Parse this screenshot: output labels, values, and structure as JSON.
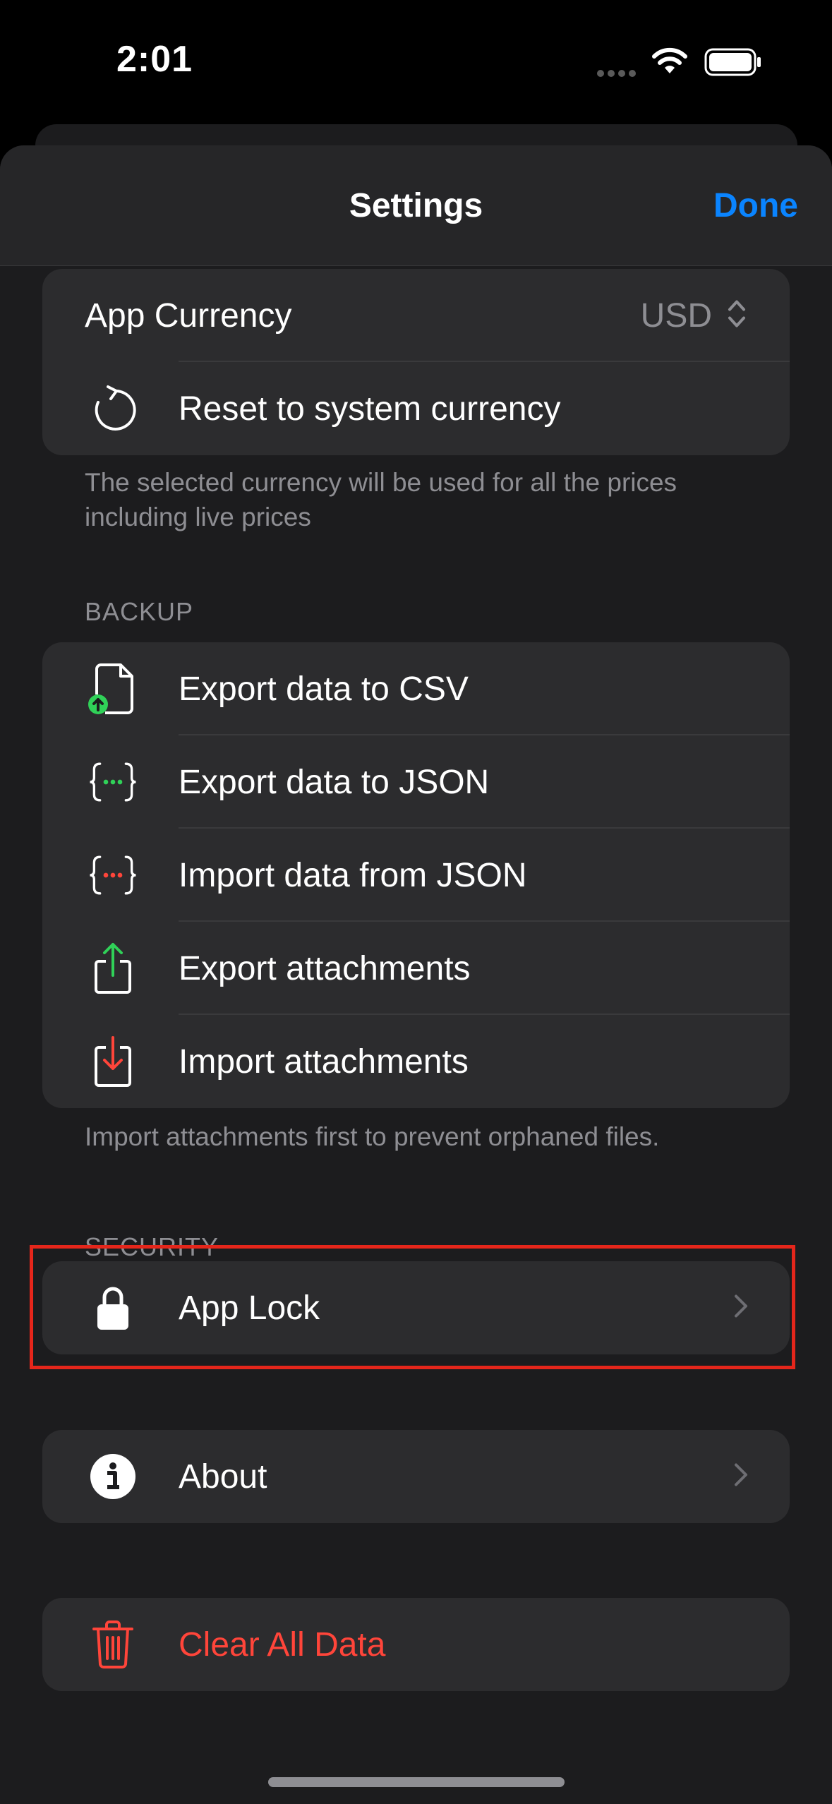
{
  "status_bar": {
    "time": "2:01"
  },
  "nav": {
    "title": "Settings",
    "done_label": "Done"
  },
  "currency_section": {
    "app_currency_label": "App Currency",
    "app_currency_value": "USD",
    "reset_label": "Reset to system currency",
    "footer": "The selected currency will be used for all the prices including live prices"
  },
  "backup_section": {
    "header": "BACKUP",
    "items": [
      {
        "label": "Export data to CSV",
        "icon": "doc-upload-icon"
      },
      {
        "label": "Export data to JSON",
        "icon": "braces-green-icon"
      },
      {
        "label": "Import data from JSON",
        "icon": "braces-red-icon"
      },
      {
        "label": "Export attachments",
        "icon": "share-up-icon"
      },
      {
        "label": "Import attachments",
        "icon": "download-tray-icon"
      }
    ],
    "footer": "Import attachments first to prevent orphaned files."
  },
  "security_section": {
    "header": "SECURITY",
    "app_lock_label": "App Lock"
  },
  "about_section": {
    "about_label": "About"
  },
  "danger_section": {
    "clear_label": "Clear All Data"
  },
  "colors": {
    "accent": "#0a84ff",
    "danger": "#ff453a",
    "success": "#30d158",
    "highlight": "#e5261b"
  }
}
